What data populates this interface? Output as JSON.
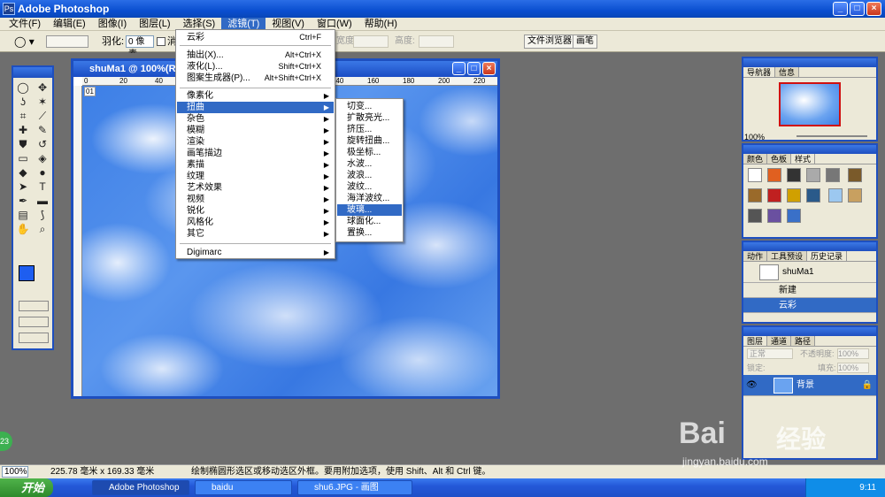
{
  "window": {
    "title": "Adobe Photoshop",
    "icon": "photoshop-icon"
  },
  "menubar": {
    "items": [
      "文件(F)",
      "编辑(E)",
      "图像(I)",
      "图层(L)",
      "选择(S)",
      "滤镜(T)",
      "视图(V)",
      "窗口(W)",
      "帮助(H)"
    ]
  },
  "options": {
    "feather_label": "羽化:",
    "feather_value": "0 像素",
    "antialias": "消",
    "width_label": "宽度:",
    "height_label": "高度:",
    "file_browser": "文件浏览器",
    "brushes": "画笔"
  },
  "document": {
    "title": "shuMa1 @ 100%(RGB)",
    "ruler_labels": [
      "0",
      "20",
      "40",
      "60",
      "80",
      "100",
      "120",
      "140",
      "160",
      "180",
      "200",
      "220"
    ],
    "corner": "01"
  },
  "filter_menu": {
    "top": [
      {
        "label": "云彩",
        "shortcut": "Ctrl+F"
      }
    ],
    "group2": [
      {
        "label": "抽出(X)...",
        "shortcut": "Alt+Ctrl+X"
      },
      {
        "label": "液化(L)...",
        "shortcut": "Shift+Ctrl+X"
      },
      {
        "label": "图案生成器(P)...",
        "shortcut": "Alt+Shift+Ctrl+X"
      }
    ],
    "group3": [
      "像素化",
      "扭曲",
      "杂色",
      "模糊",
      "渲染",
      "画笔描边",
      "素描",
      "纹理",
      "艺术效果",
      "视频",
      "锐化",
      "风格化",
      "其它"
    ],
    "group4": [
      "Digimarc"
    ]
  },
  "distort_menu": {
    "items": [
      "切变...",
      "扩散亮光...",
      "挤压...",
      "旋转扭曲...",
      "极坐标...",
      "水波...",
      "波浪...",
      "波纹...",
      "海洋波纹...",
      "玻璃...",
      "球面化...",
      "置换..."
    ],
    "highlighted": "玻璃..."
  },
  "navigator": {
    "tabs": [
      "导航器",
      "信息"
    ],
    "zoom": "100%"
  },
  "styles": {
    "tabs": [
      "颜色",
      "色板",
      "样式"
    ]
  },
  "history": {
    "tabs": [
      "动作",
      "工具预设",
      "历史记录"
    ],
    "snapshot": "shuMa1",
    "items": [
      "新建",
      "云彩"
    ]
  },
  "layers": {
    "tabs": [
      "图层",
      "通道",
      "路径"
    ],
    "mode": "正常",
    "opacity_label": "不透明度:",
    "opacity": "100%",
    "lock_label": "锁定:",
    "fill_label": "填充:",
    "fill": "100%",
    "layer": "背景"
  },
  "status": {
    "zoom": "100%",
    "size": "225.78 毫米 x 169.33 毫米",
    "hint": "绘制椭圆形选区或移动选区外框。要用附加选项，使用 Shift、Alt 和 Ctrl 键。"
  },
  "taskbar": {
    "start": "开始",
    "tasks": [
      "Adobe Photoshop",
      "baidu",
      "shu6.JPG - 画图"
    ],
    "time": "9:11"
  },
  "badge": "23",
  "watermark": {
    "brand": "Bai",
    "brand2": "经验",
    "url": "jingyan.baidu.com"
  }
}
